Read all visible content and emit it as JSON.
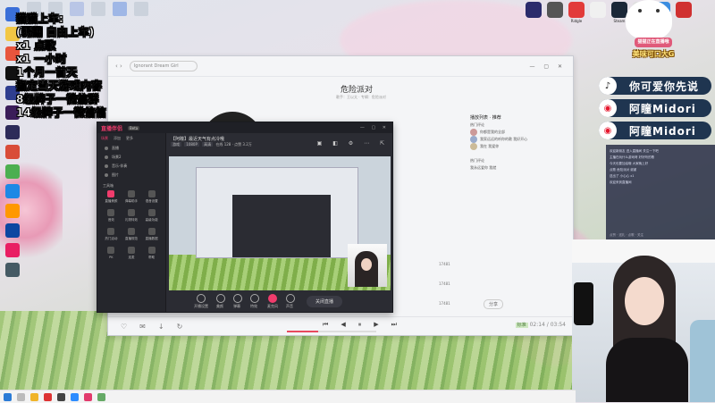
{
  "overlay_lines": [
    "猫猫上车:",
    "(弱翻 自由上车)",
    "x1 点歌",
    "x1 一小时",
    "1个月一首天",
    "指定当天游戏内容",
    "8级牌子一微信群",
    "14级牌子一微信信"
  ],
  "tray_labels": [
    "",
    "",
    "Ridgle",
    "",
    "Steam",
    "",
    "",
    ""
  ],
  "slogan": {
    "line1": "猫猫正在直播哦",
    "line2": "美味可口大G"
  },
  "social": [
    {
      "name": "douyin",
      "text": "你可爱你先说",
      "icon": "♪"
    },
    {
      "name": "weibo",
      "text": "阿瞳Midori",
      "icon": "◉"
    },
    {
      "name": "weibo2",
      "text": "阿瞳Midori",
      "icon": "◉"
    }
  ],
  "music_window": {
    "search_placeholder": "Ignorant Dream Girl",
    "window_controls": "— ▢ ✕",
    "song_title": "危险派对",
    "song_sub": "歌手：王以太 · 专辑：危险派对",
    "lyrics_header": "播放列表 · 推荐",
    "lyrics": [
      "热门评论",
      "你都是我的全部",
      "我家远远的听你的歌 我好开心",
      "我在 我爱你",
      "热门评论",
      "我永远爱你 我就"
    ],
    "comment_counts": [
      "17481",
      "17481",
      "17481"
    ],
    "share": "分享",
    "controls": [
      "⏮",
      "◀",
      "⏸",
      "▶",
      "⏭"
    ],
    "progress": 0.35,
    "volume_badge": "标准",
    "time": "02:14 / 03:54"
  },
  "stream_app": {
    "logo": "直播伴侣",
    "beta": "Beta",
    "window_controls": "— ▢ ✕",
    "tabs": [
      "场景",
      "添加",
      "更多"
    ],
    "scenes": [
      "直播",
      "场景2",
      "音乐·伴奏",
      "图片"
    ],
    "tools_header": "工具箱",
    "tools": [
      {
        "label": "直播美颜",
        "on": true
      },
      {
        "label": "弹幕助手",
        "on": false
      },
      {
        "label": "语音设置",
        "on": false
      },
      {
        "label": "音效",
        "on": false
      },
      {
        "label": "礼物特效",
        "on": false
      },
      {
        "label": "高级功能",
        "on": false
      },
      {
        "label": "热门活动",
        "on": false
      },
      {
        "label": "直播规范",
        "on": false
      },
      {
        "label": "直播数据",
        "on": false
      },
      {
        "label": "PK",
        "on": false
      },
      {
        "label": "连麦",
        "on": false
      },
      {
        "label": "帮助",
        "on": false
      }
    ],
    "room_title": "【阿瞳】最近天气有点冷哦",
    "room_tags": [
      "游戏",
      "1080P",
      "高清"
    ],
    "room_stats": "在线 128 · 点赞 3.2万",
    "bottom_buttons": [
      {
        "label": "开播设置",
        "red": false
      },
      {
        "label": "美颜",
        "red": false
      },
      {
        "label": "弹幕",
        "red": false
      },
      {
        "label": "特效",
        "red": false
      },
      {
        "label": "麦克风",
        "red": true
      },
      {
        "label": "声音",
        "red": false
      }
    ],
    "go_live": "关闭直播"
  },
  "chat_lines": [
    "欢迎新朋友 进入直播间 关注一下吧",
    "主播在玩什么游戏呀 好好听的歌",
    "今天也要加油哦 大家晚上好",
    "点歌 危险派对 谢谢",
    "送出了 小心心 x1",
    "欢迎来到直播间"
  ],
  "chat_footer": "点赞 · 送礼 · 点歌 · 关注"
}
